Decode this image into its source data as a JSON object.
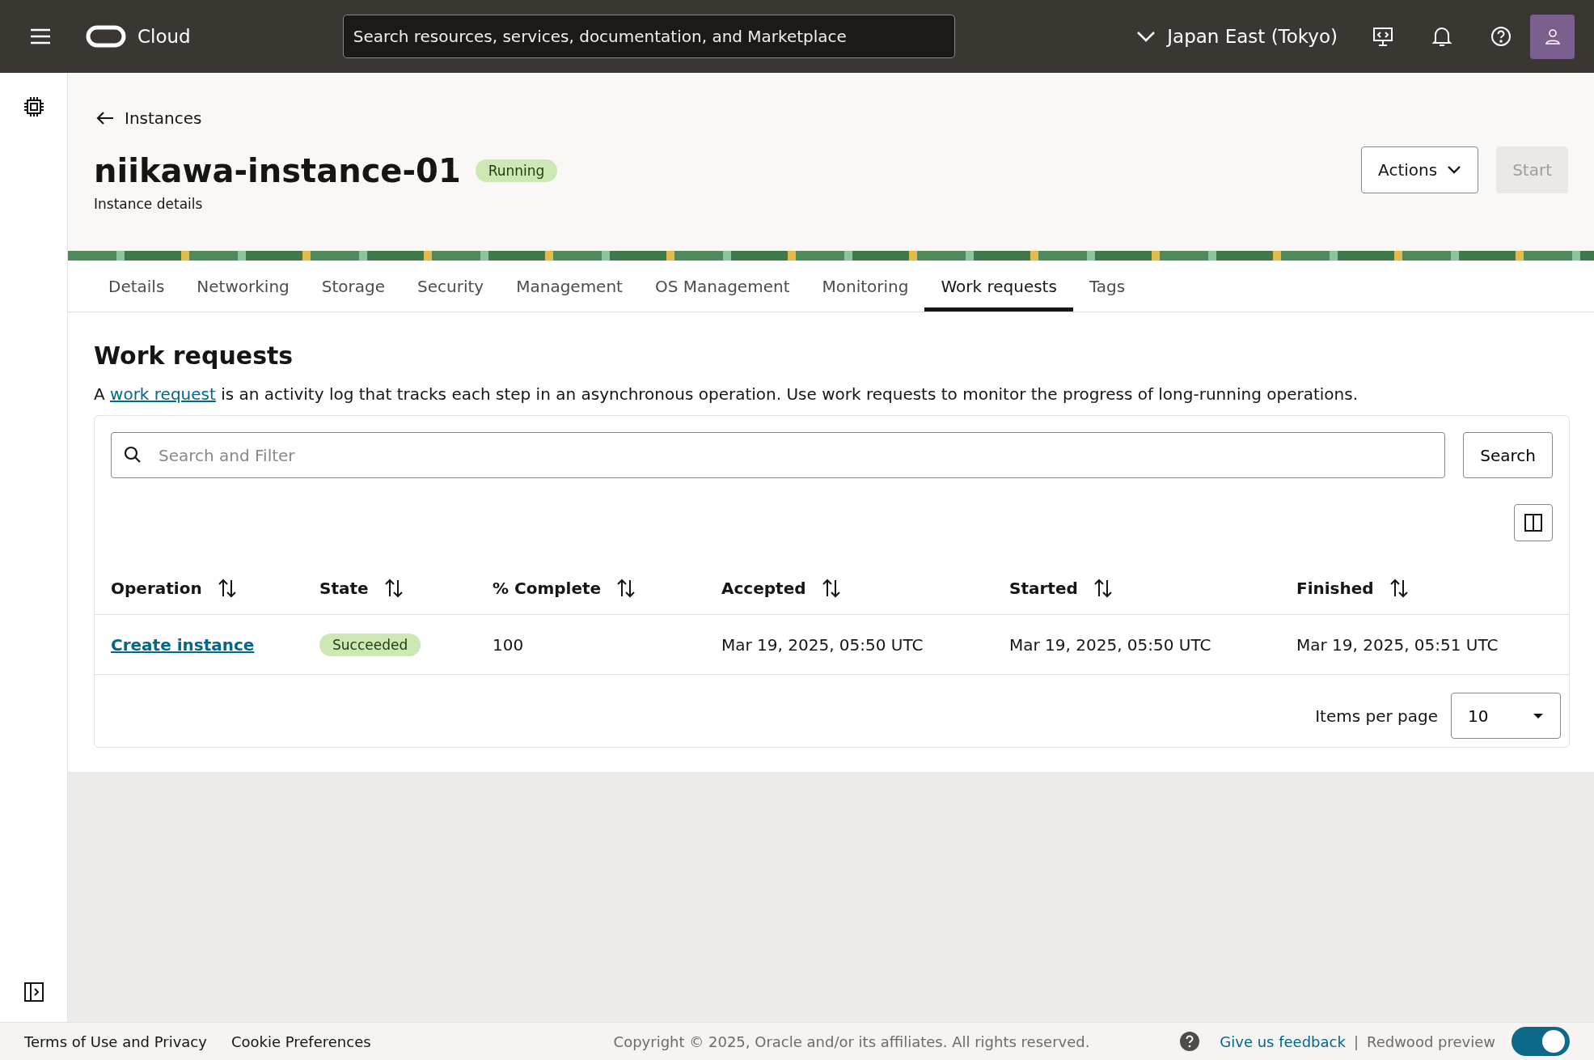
{
  "header": {
    "brand": "Cloud",
    "search": {
      "placeholder": "Search resources, services, documentation, and Marketplace"
    },
    "region": "Japan East (Tokyo)"
  },
  "breadcrumb": "Instances",
  "title": "niikawa-instance-01",
  "status": "Running",
  "subtitle": "Instance details",
  "actions": [
    {
      "label": "Actions",
      "kind": "menu",
      "disabled": false
    },
    {
      "label": "Start",
      "kind": "plain",
      "disabled": true
    }
  ],
  "tabs": [
    {
      "label": "Details",
      "selected": false
    },
    {
      "label": "Networking",
      "selected": false
    },
    {
      "label": "Storage",
      "selected": false
    },
    {
      "label": "Security",
      "selected": false
    },
    {
      "label": "Management",
      "selected": false
    },
    {
      "label": "OS Management",
      "selected": false
    },
    {
      "label": "Monitoring",
      "selected": false
    },
    {
      "label": "Work requests",
      "selected": true
    },
    {
      "label": "Tags",
      "selected": false
    }
  ],
  "section": {
    "title": "Work requests",
    "description_parts": [
      "A ",
      "work request",
      " is an activity log that tracks each step in an asynchronous operation. Use work requests to monitor the progress of long-running operations."
    ]
  },
  "filter": {
    "placeholder": "Search and Filter",
    "button": "Search"
  },
  "table": {
    "columns": [
      "Operation",
      "State",
      "% Complete",
      "Accepted",
      "Started",
      "Finished"
    ],
    "rows": [
      {
        "operation": "Create instance",
        "state": "Succeeded",
        "complete": "100",
        "accepted": "Mar 19, 2025, 05:50 UTC",
        "started": "Mar 19, 2025, 05:50 UTC",
        "finished": "Mar 19, 2025, 05:51 UTC"
      }
    ]
  },
  "pagination": {
    "label": "Items per page",
    "value": "10"
  },
  "footer": {
    "links": [
      "Terms of Use and Privacy",
      "Cookie Preferences"
    ],
    "copyright": "Copyright © 2025, Oracle and/or its affiliates. All rights reserved.",
    "feedback": "Give us feedback",
    "separator": "|",
    "preview": {
      "label": "Redwood preview",
      "on": true
    }
  }
}
